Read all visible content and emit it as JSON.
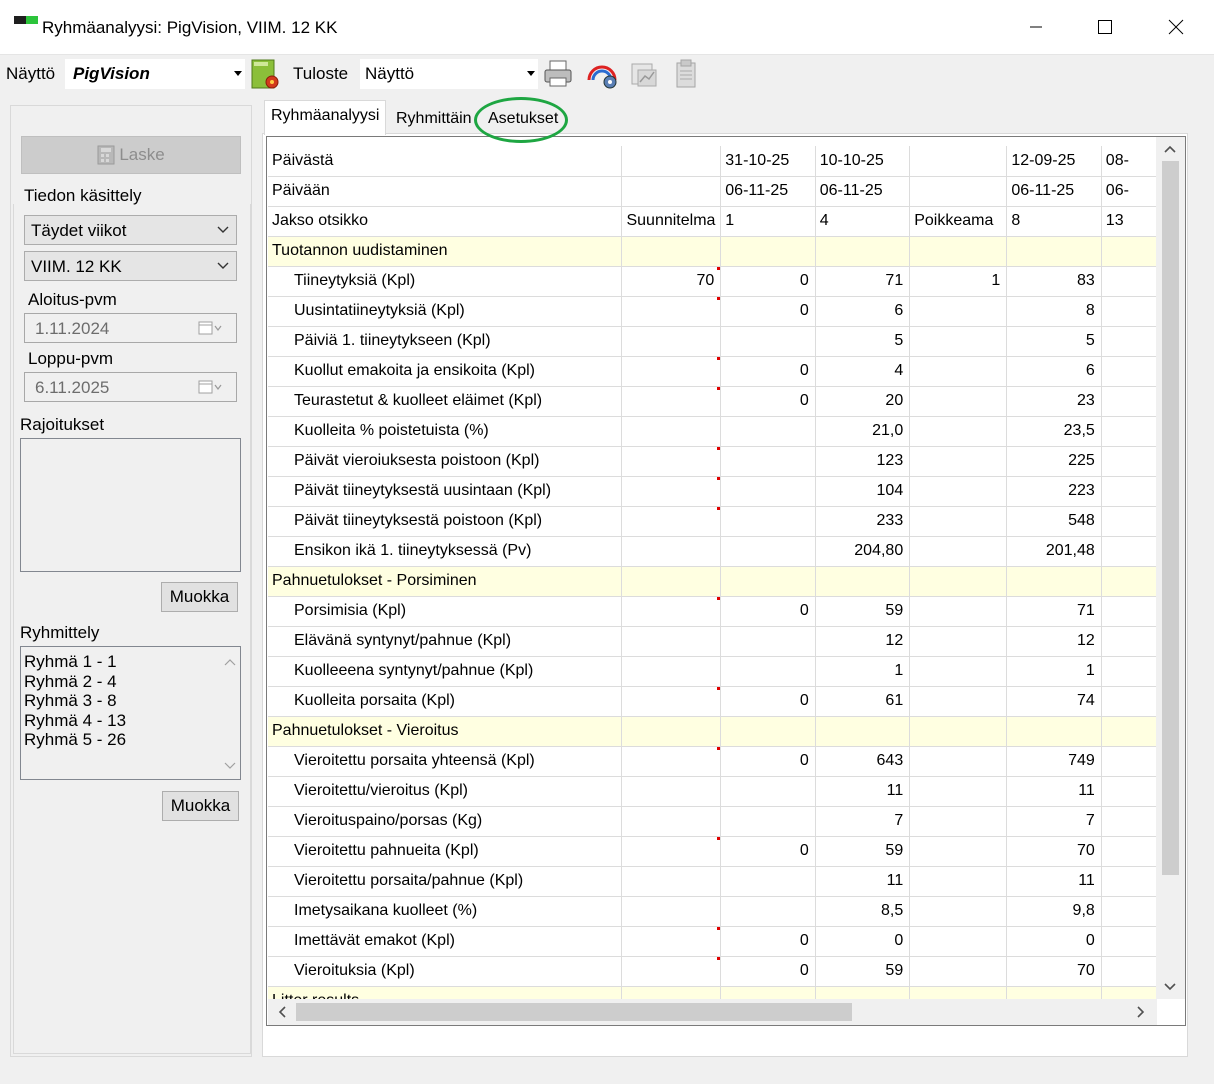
{
  "window": {
    "title": "Ryhmäanalyysi: PigVision, VIIM. 12 KK"
  },
  "toolbar": {
    "view_label": "Näyttö",
    "view_value": "PigVision",
    "print_label": "Tuloste",
    "print_value": "Näyttö",
    "icons": [
      "calculate-report-icon",
      "printer-icon",
      "chart-settings-icon",
      "chart-icon",
      "clipboard-icon"
    ]
  },
  "left": {
    "calculate_label": "Laske",
    "data_handling_label": "Tiedon käsittely",
    "period_type": "Täydet viikot",
    "period_range": "VIIM. 12 KK",
    "start_label": "Aloitus-pvm",
    "start_value": "1.11.2024",
    "end_label": "Loppu-pvm",
    "end_value": "6.11.2025",
    "restrictions_label": "Rajoitukset",
    "edit1_label": "Muokka",
    "grouping_label": "Ryhmittely",
    "groups": [
      "Ryhmä 1 - 1",
      "Ryhmä 2 - 4",
      "Ryhmä 3 - 8",
      "Ryhmä 4 - 13",
      "Ryhmä 5 - 26"
    ],
    "edit2_label": "Muokka"
  },
  "tabs": [
    "Ryhmäanalyysi",
    "Ryhmittäin",
    "Asetukset"
  ],
  "grid": {
    "header_rows": [
      [
        "Päivästä",
        "",
        "31-10-25",
        "10-10-25",
        "",
        "12-09-25",
        "08-"
      ],
      [
        "Päivään",
        "",
        "06-11-25",
        "06-11-25",
        "",
        "06-11-25",
        "06-"
      ],
      [
        "Jakso otsikko",
        "Suunnitelma",
        "1",
        "4",
        "Poikkeama",
        "8",
        "13"
      ]
    ],
    "sections": [
      {
        "title": "Tuotannon uudistaminen",
        "rows": [
          {
            "label": "Tiineytyksiä (Kpl)",
            "values": [
              "70",
              "0",
              "71",
              "1",
              "83",
              ""
            ],
            "mark": true
          },
          {
            "label": "Uusintatiineytyksiä (Kpl)",
            "values": [
              "",
              "0",
              "6",
              "",
              "8",
              ""
            ],
            "mark": true
          },
          {
            "label": "Päiviä 1. tiineytykseen (Kpl)",
            "values": [
              "",
              "",
              "5",
              "",
              "5",
              ""
            ],
            "mark": false
          },
          {
            "label": "Kuollut emakoita ja ensikoita (Kpl)",
            "values": [
              "",
              "0",
              "4",
              "",
              "6",
              ""
            ],
            "mark": true
          },
          {
            "label": "Teurastetut & kuolleet eläimet (Kpl)",
            "values": [
              "",
              "0",
              "20",
              "",
              "23",
              ""
            ],
            "mark": true
          },
          {
            "label": "Kuolleita % poistetuista (%)",
            "values": [
              "",
              "",
              "21,0",
              "",
              "23,5",
              ""
            ],
            "mark": false
          },
          {
            "label": "Päivät vieroiuksesta poistoon (Kpl)",
            "values": [
              "",
              "",
              "123",
              "",
              "225",
              ""
            ],
            "mark": true
          },
          {
            "label": "Päivät tiineytyksestä uusintaan (Kpl)",
            "values": [
              "",
              "",
              "104",
              "",
              "223",
              ""
            ],
            "mark": true
          },
          {
            "label": "Päivät tiineytyksestä poistoon (Kpl)",
            "values": [
              "",
              "",
              "233",
              "",
              "548",
              ""
            ],
            "mark": true
          },
          {
            "label": "Ensikon ikä 1. tiineytyksessä (Pv)",
            "values": [
              "",
              "",
              "204,80",
              "",
              "201,48",
              ""
            ],
            "mark": false
          }
        ]
      },
      {
        "title": "Pahnuetulokset - Porsiminen",
        "rows": [
          {
            "label": "Porsimisia (Kpl)",
            "values": [
              "",
              "0",
              "59",
              "",
              "71",
              ""
            ],
            "mark": true
          },
          {
            "label": "Elävänä syntynyt/pahnue (Kpl)",
            "values": [
              "",
              "",
              "12",
              "",
              "12",
              ""
            ],
            "mark": false
          },
          {
            "label": "Kuolleeena syntynyt/pahnue (Kpl)",
            "values": [
              "",
              "",
              "1",
              "",
              "1",
              ""
            ],
            "mark": false
          },
          {
            "label": "Kuolleita porsaita (Kpl)",
            "values": [
              "",
              "0",
              "61",
              "",
              "74",
              ""
            ],
            "mark": true
          }
        ]
      },
      {
        "title": "Pahnuetulokset - Vieroitus",
        "rows": [
          {
            "label": "Vieroitettu porsaita yhteensä (Kpl)",
            "values": [
              "",
              "0",
              "643",
              "",
              "749",
              ""
            ],
            "mark": true
          },
          {
            "label": "Vieroitettu/vieroitus (Kpl)",
            "values": [
              "",
              "",
              "11",
              "",
              "11",
              ""
            ],
            "mark": false
          },
          {
            "label": "Vieroituspaino/porsas (Kg)",
            "values": [
              "",
              "",
              "7",
              "",
              "7",
              ""
            ],
            "mark": false
          },
          {
            "label": "Vieroitettu pahnueita (Kpl)",
            "values": [
              "",
              "0",
              "59",
              "",
              "70",
              ""
            ],
            "mark": true
          },
          {
            "label": "Vieroitettu porsaita/pahnue (Kpl)",
            "values": [
              "",
              "",
              "11",
              "",
              "11",
              ""
            ],
            "mark": false
          },
          {
            "label": "Imetysaikana kuolleet (%)",
            "values": [
              "",
              "",
              "8,5",
              "",
              "9,8",
              ""
            ],
            "mark": false
          },
          {
            "label": "Imettävät emakot (Kpl)",
            "values": [
              "",
              "0",
              "0",
              "",
              "0",
              ""
            ],
            "mark": true
          },
          {
            "label": "Vieroituksia (Kpl)",
            "values": [
              "",
              "0",
              "59",
              "",
              "70",
              ""
            ],
            "mark": true
          }
        ]
      },
      {
        "title": "Litter results",
        "rows": []
      }
    ]
  },
  "colors": {
    "section_bg": "#ffffe1",
    "highlight_ring": "#1ea642",
    "mark_red": "#e00000"
  }
}
